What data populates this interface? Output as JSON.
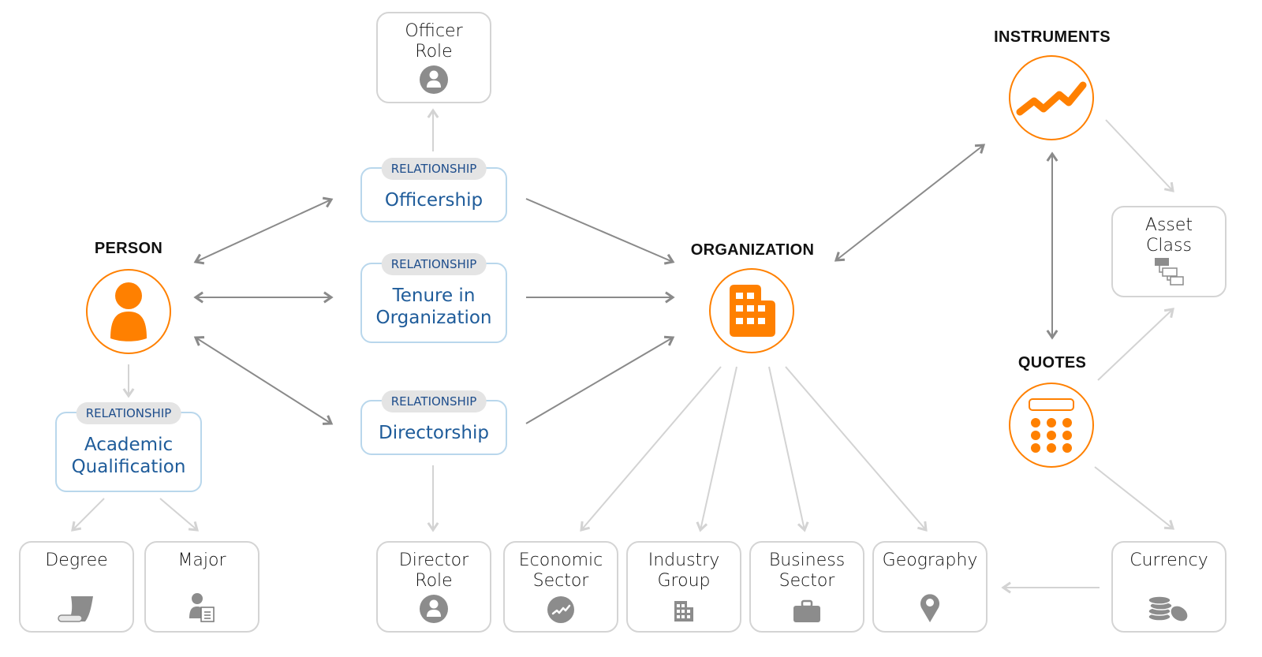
{
  "colors": {
    "accent": "#ff8000",
    "primary_arrow": "#8a8a8a",
    "secondary_arrow": "#d3d3d3",
    "relationship_border": "#b9d7ec",
    "relationship_text": "#1f5c9a",
    "tag_background": "#e4e4e4",
    "leaf_icon": "#8c8c8c"
  },
  "entities": {
    "person": {
      "title": "PERSON",
      "icon": "person-icon"
    },
    "organization": {
      "title": "ORGANIZATION",
      "icon": "building-icon"
    },
    "instruments": {
      "title": "INSTRUMENTS",
      "icon": "trend-line-icon"
    },
    "quotes": {
      "title": "QUOTES",
      "icon": "calculator-icon"
    }
  },
  "relationships": {
    "tag": "RELATIONSHIP",
    "officership": "Officership",
    "tenure": "Tenure in\nOrganization",
    "directorship": "Directorship",
    "academic": "Academic\nQualification"
  },
  "leaves": {
    "officer_role": {
      "label": "Officer\nRole",
      "icon": "person-badge-icon"
    },
    "director_role": {
      "label": "Director\nRole",
      "icon": "person-badge-icon"
    },
    "degree": {
      "label": "Degree",
      "icon": "scroll-icon"
    },
    "major": {
      "label": "Major",
      "icon": "person-document-icon"
    },
    "economic_sector": {
      "label": "Economic\nSector",
      "icon": "trend-circle-icon"
    },
    "industry_group": {
      "label": "Industry\nGroup",
      "icon": "building-icon"
    },
    "business_sector": {
      "label": "Business\nSector",
      "icon": "briefcase-icon"
    },
    "geography": {
      "label": "Geography",
      "icon": "map-pin-icon"
    },
    "asset_class": {
      "label": "Asset\nClass",
      "icon": "hierarchy-icon"
    },
    "currency": {
      "label": "Currency",
      "icon": "coins-icon"
    }
  },
  "edges": [
    {
      "from": "officership",
      "to": "person",
      "bidirectional": true,
      "style": "primary"
    },
    {
      "from": "tenure",
      "to": "person",
      "bidirectional": true,
      "style": "primary"
    },
    {
      "from": "directorship",
      "to": "person",
      "bidirectional": true,
      "style": "primary"
    },
    {
      "from": "officership",
      "to": "organization",
      "bidirectional": false,
      "style": "primary"
    },
    {
      "from": "tenure",
      "to": "organization",
      "bidirectional": false,
      "style": "primary"
    },
    {
      "from": "directorship",
      "to": "organization",
      "bidirectional": false,
      "style": "primary"
    },
    {
      "from": "organization",
      "to": "instruments",
      "bidirectional": true,
      "style": "primary"
    },
    {
      "from": "instruments",
      "to": "quotes",
      "bidirectional": true,
      "style": "primary"
    },
    {
      "from": "officership",
      "to": "officer_role",
      "bidirectional": false,
      "style": "secondary"
    },
    {
      "from": "directorship",
      "to": "director_role",
      "bidirectional": false,
      "style": "secondary"
    },
    {
      "from": "person",
      "to": "academic",
      "bidirectional": false,
      "style": "secondary"
    },
    {
      "from": "academic",
      "to": "degree",
      "bidirectional": false,
      "style": "secondary"
    },
    {
      "from": "academic",
      "to": "major",
      "bidirectional": false,
      "style": "secondary"
    },
    {
      "from": "organization",
      "to": "economic_sector",
      "bidirectional": false,
      "style": "secondary"
    },
    {
      "from": "organization",
      "to": "industry_group",
      "bidirectional": false,
      "style": "secondary"
    },
    {
      "from": "organization",
      "to": "business_sector",
      "bidirectional": false,
      "style": "secondary"
    },
    {
      "from": "organization",
      "to": "geography",
      "bidirectional": false,
      "style": "secondary"
    },
    {
      "from": "instruments",
      "to": "asset_class",
      "bidirectional": false,
      "style": "secondary"
    },
    {
      "from": "quotes",
      "to": "asset_class",
      "bidirectional": false,
      "style": "secondary"
    },
    {
      "from": "quotes",
      "to": "currency",
      "bidirectional": false,
      "style": "secondary"
    },
    {
      "from": "currency",
      "to": "geography",
      "bidirectional": false,
      "style": "secondary"
    }
  ]
}
